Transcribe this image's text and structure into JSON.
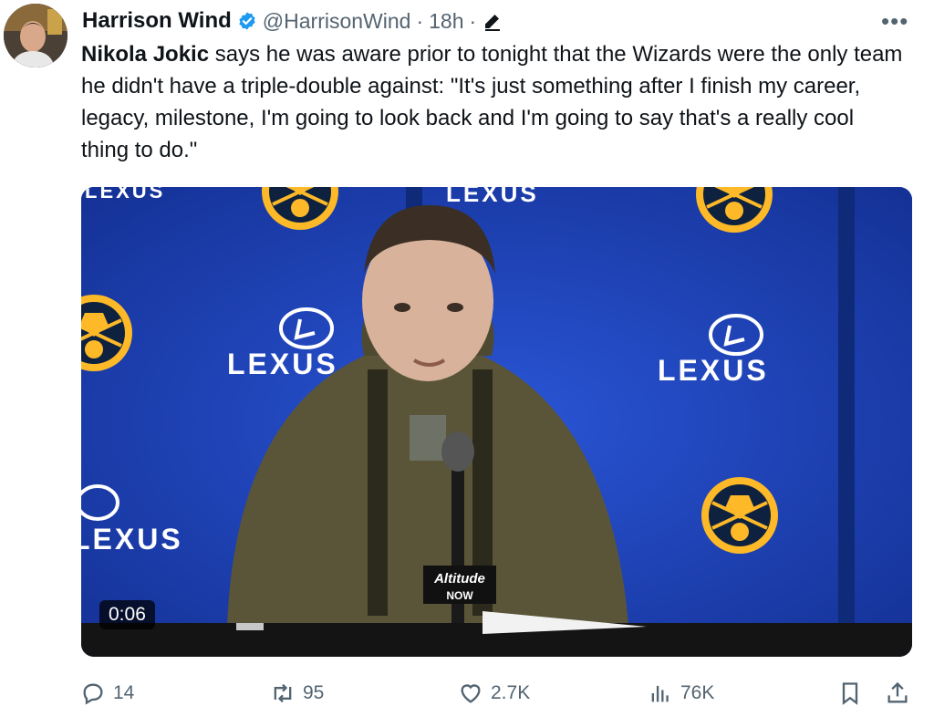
{
  "author": {
    "name": "Harrison Wind",
    "handle": "@HarrisonWind",
    "time": "18h",
    "separator": "·",
    "verified": true
  },
  "post": {
    "mention": "Nikola Jokic",
    "text": " says he was aware prior to tonight that the Wizards were the only team he didn't have a triple-double against: \"It's just something after I finish my career, legacy, milestone, I'm going to look back and I'm going to say that's a really cool thing to do.\""
  },
  "video": {
    "duration": "0:06",
    "backdrop_text": "LEXUS",
    "mic_flag_top": "Altitude",
    "mic_flag_bottom": "NOW"
  },
  "actions": {
    "replies": "14",
    "reposts": "95",
    "likes": "2.7K",
    "views": "76K"
  },
  "more_label": "•••",
  "colors": {
    "verified_blue": "#1d9bf0",
    "secondary_text": "#536471",
    "backdrop_blue": "#1b3fb3",
    "nuggets_gold": "#fdb927"
  }
}
